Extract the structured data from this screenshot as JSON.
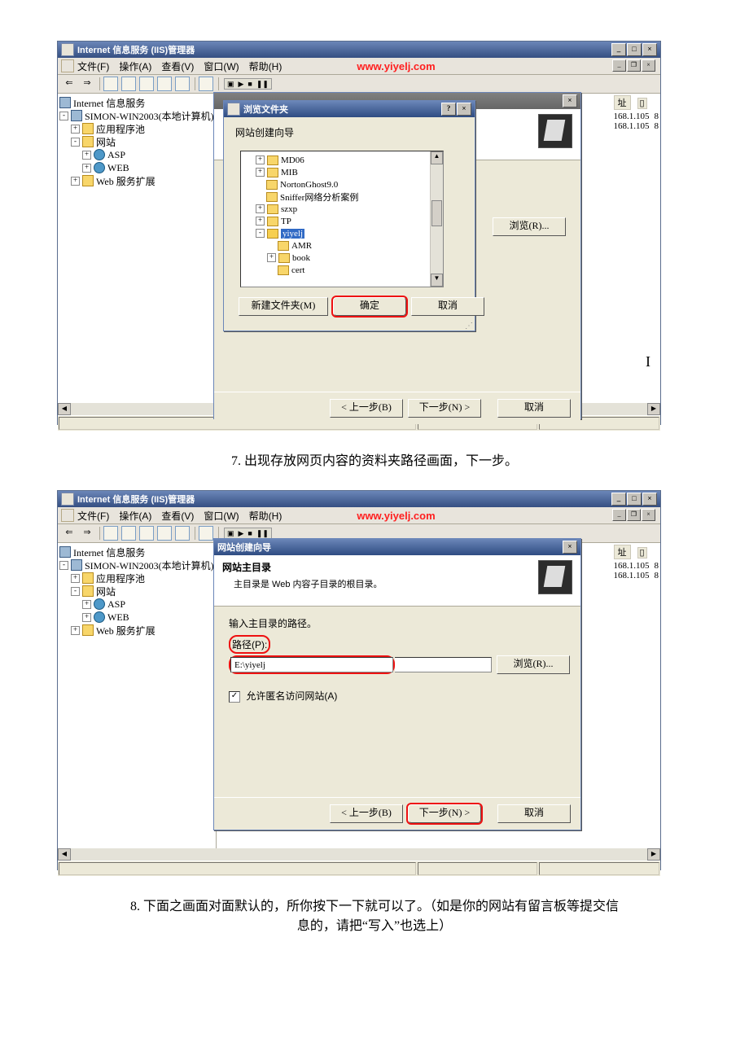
{
  "shot1": {
    "title": "Internet 信息服务 (IIS)管理器",
    "menus": [
      "文件(F)",
      "操作(A)",
      "查看(V)",
      "窗口(W)",
      "帮助(H)"
    ],
    "watermark": "www.yiyelj.com",
    "tree": {
      "root": "Internet 信息服务",
      "host": "SIMON-WIN2003(本地计算机)",
      "pool": "应用程序池",
      "sites": "网站",
      "asp": "ASP",
      "web": "WEB",
      "ext": "Web 服务扩展"
    },
    "right": {
      "hdr": "址",
      "ip1": "168.1.105",
      "ip2": "168.1.105"
    },
    "browseDlg": {
      "title": "浏览文件夹",
      "subtitle": "网站创建向导",
      "items": {
        "md06": "MD06",
        "mib": "MIB",
        "norton": "NortonGhost9.0",
        "sniffer": "Sniffer网络分析案例",
        "szxp": "szxp",
        "tp": "TP",
        "yiyelj": "yiyelj",
        "amr": "AMR",
        "book": "book",
        "cert": "cert"
      },
      "btnNewFolder": "新建文件夹(M)",
      "btnOk": "确定",
      "btnCancel": "取消"
    },
    "wizard": {
      "btnBrowse": "浏览(R)...",
      "btnBack": "< 上一步(B)",
      "btnNext": "下一步(N) >",
      "btnCancel": "取消"
    }
  },
  "caption7": "7. 出现存放网页内容的资料夹路径画面，下一步。",
  "shot2": {
    "title": "Internet 信息服务 (IIS)管理器",
    "menus": [
      "文件(F)",
      "操作(A)",
      "查看(V)",
      "窗口(W)",
      "帮助(H)"
    ],
    "watermark": "www.yiyelj.com",
    "tree": {
      "root": "Internet 信息服务",
      "host": "SIMON-WIN2003(本地计算机)",
      "pool": "应用程序池",
      "sites": "网站",
      "asp": "ASP",
      "web": "WEB",
      "ext": "Web 服务扩展"
    },
    "right": {
      "hdr": "址",
      "ip1": "168.1.105",
      "ip2": "168.1.105"
    },
    "wizard": {
      "title": "网站创建向导",
      "h1": "网站主目录",
      "h2": "主目录是 Web 内容子目录的根目录。",
      "label1": "输入主目录的路径。",
      "label2": "路径(P):",
      "path": "E:\\yiyelj",
      "btnBrowse": "浏览(R)...",
      "chk": "允许匿名访问网站(A)",
      "btnBack": "< 上一步(B)",
      "btnNext": "下一步(N) >",
      "btnCancel": "取消"
    }
  },
  "caption8a": "8. 下面之画面对面默认的，所你按下一下就可以了。（如是你的网站有留言板等提交信",
  "caption8b": "息的，请把“写入”也选上）"
}
